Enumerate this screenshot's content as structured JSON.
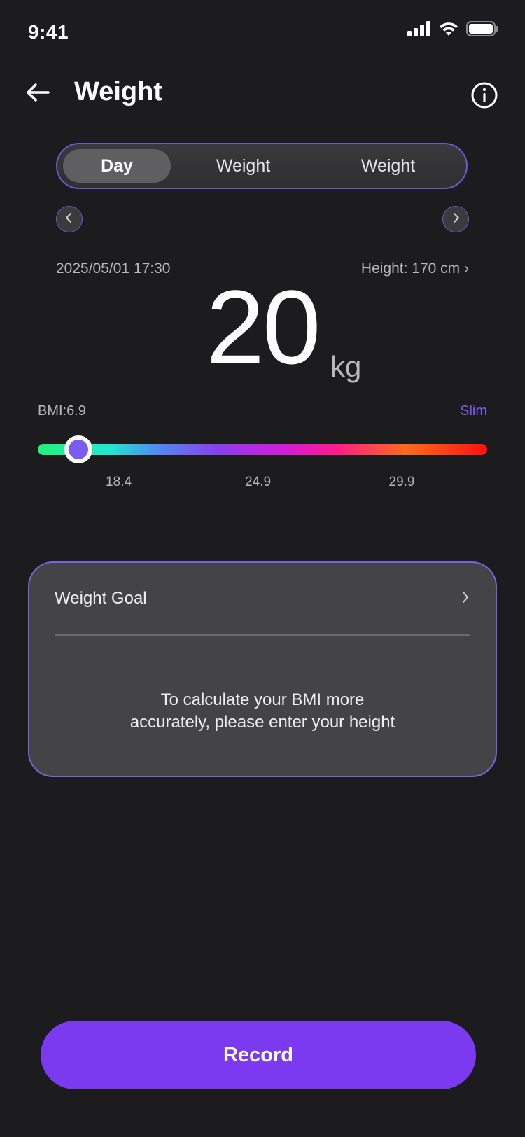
{
  "status_bar": {
    "time": "9:41"
  },
  "header": {
    "title": "Weight",
    "back_icon": "arrow-left-icon",
    "info_icon": "info-circle-icon"
  },
  "tabs": [
    {
      "label": "Day",
      "active": true
    },
    {
      "label": "Weight",
      "active": false
    },
    {
      "label": "Weight",
      "active": false
    }
  ],
  "reading": {
    "datetime": "2025/05/01 17:30",
    "height_link": "Height: 170 cm  ›",
    "weight_value": "20",
    "weight_unit": "kg"
  },
  "bmi": {
    "label": "BMI:6.9",
    "status": "Slim",
    "thumb_position": 0.09,
    "ticks": [
      {
        "label": "18.4",
        "position": 0.18
      },
      {
        "label": "24.9",
        "position": 0.49
      },
      {
        "label": "29.9",
        "position": 0.81
      }
    ]
  },
  "goal_card": {
    "title": "Weight Goal",
    "message_line1": "To calculate your BMI more",
    "message_line2": "accurately, please enter your height"
  },
  "record_button": {
    "label": "Record"
  },
  "colors": {
    "accent": "#7c3af0",
    "slim_status": "#7b5cf0",
    "background": "#1c1c1e",
    "card": "#444446"
  }
}
